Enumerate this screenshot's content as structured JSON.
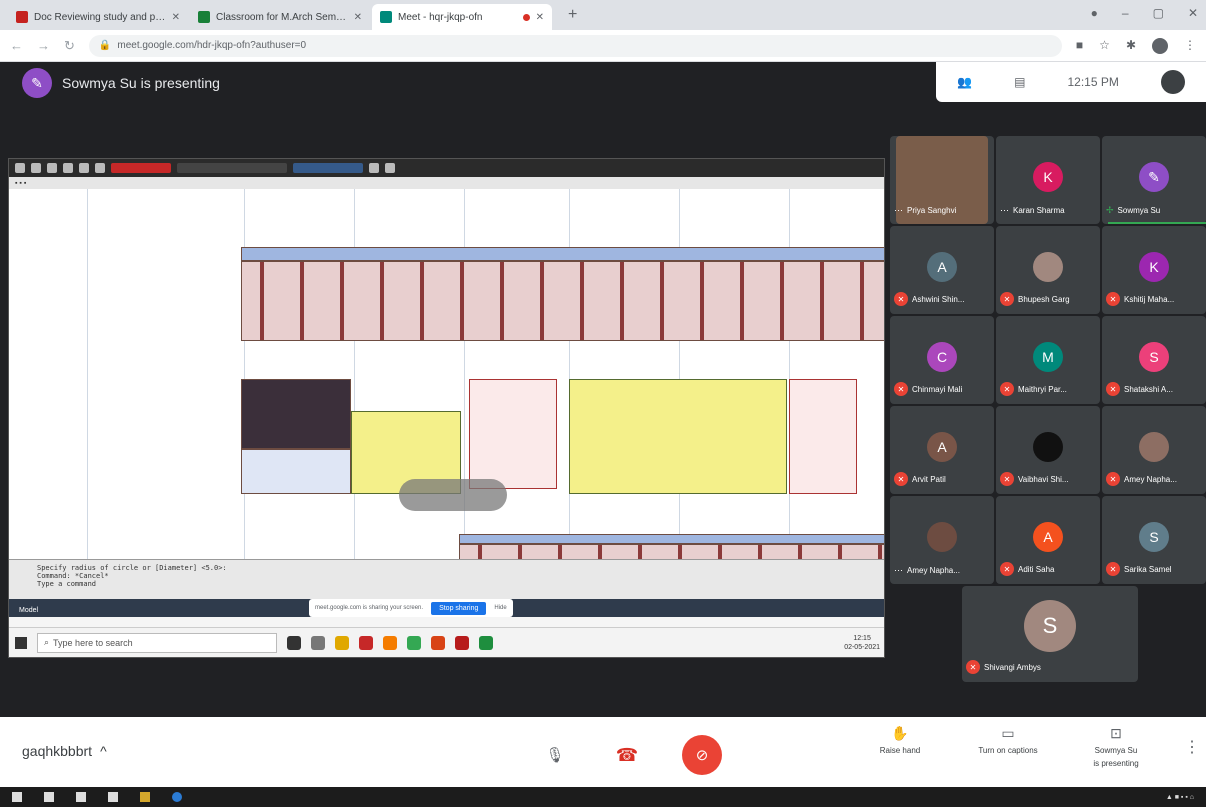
{
  "browser": {
    "tabs": [
      {
        "title": "Doc Reviewing study and papers",
        "active": false,
        "favicon_color": "#c5221f"
      },
      {
        "title": "Classroom for M.Arch Semester",
        "active": false,
        "favicon_color": "#188038"
      },
      {
        "title": "Meet - hqr-jkqp-ofn",
        "active": true,
        "favicon_color": "#00897b"
      }
    ],
    "url": "meet.google.com/hdr-jkqp-ofn?authuser=0"
  },
  "meet": {
    "presenting_label": "Sowmya Su is presenting",
    "time": "12:15 PM",
    "meeting_code": "gaqhkbbbrt",
    "participants": [
      {
        "name": "Priya Sanghvi",
        "initial": "",
        "color": "#7a5d4a",
        "muted": false,
        "camera": true
      },
      {
        "name": "Karan Sharma",
        "initial": "K",
        "color": "#d81b60",
        "muted": false
      },
      {
        "name": "Sowmya Su",
        "initial": "",
        "color": "#8e4ec6",
        "muted": false,
        "speaking": true
      },
      {
        "name": "Ashwini Shin...",
        "initial": "A",
        "color": "#546e7a",
        "muted": true
      },
      {
        "name": "Bhupesh Garg",
        "initial": "",
        "color": "#a1887f",
        "muted": true
      },
      {
        "name": "Kshitij Maha...",
        "initial": "K",
        "color": "#9c27b0",
        "muted": true
      },
      {
        "name": "Chinmayi Mali",
        "initial": "C",
        "color": "#ab47bc",
        "muted": true
      },
      {
        "name": "Maithryi Par...",
        "initial": "M",
        "color": "#00897b",
        "muted": true
      },
      {
        "name": "Shatakshi A...",
        "initial": "S",
        "color": "#ec407a",
        "muted": true
      },
      {
        "name": "Arvit Patil",
        "initial": "A",
        "color": "#795548",
        "muted": true
      },
      {
        "name": "Vaibhavi Shi...",
        "initial": "",
        "color": "#111111",
        "muted": true
      },
      {
        "name": "Amey Napha...",
        "initial": "",
        "color": "#8d6e63",
        "muted": true
      },
      {
        "name": "Amey Napha...",
        "initial": "",
        "color": "#6d4c41",
        "muted": false
      },
      {
        "name": "Aditi Saha",
        "initial": "A",
        "color": "#f4511e",
        "muted": true
      },
      {
        "name": "Sarika Samel",
        "initial": "S",
        "color": "#607d8b",
        "muted": true
      },
      {
        "name": "Shivangi Ambys",
        "initial": "S",
        "color": "#a1887f",
        "muted": true
      }
    ],
    "controls": {
      "raise_hand": "Raise hand",
      "captions": "Turn on captions",
      "presenting_line1": "Sowmya Su",
      "presenting_line2": "is presenting"
    }
  },
  "shared_screen": {
    "cmd_line1": "Specify radius of circle or [Diameter] <5.0>:",
    "cmd_line2": "Command: *Cancel*",
    "cmd_prompt": "Type a command",
    "share_text": "meet.google.com is sharing your screen.",
    "share_stop": "Stop sharing",
    "share_hide": "Hide",
    "taskbar_search": "Type here to search",
    "taskbar_time": "12:15",
    "taskbar_date": "02-05-2021",
    "model_tab": "Model"
  }
}
